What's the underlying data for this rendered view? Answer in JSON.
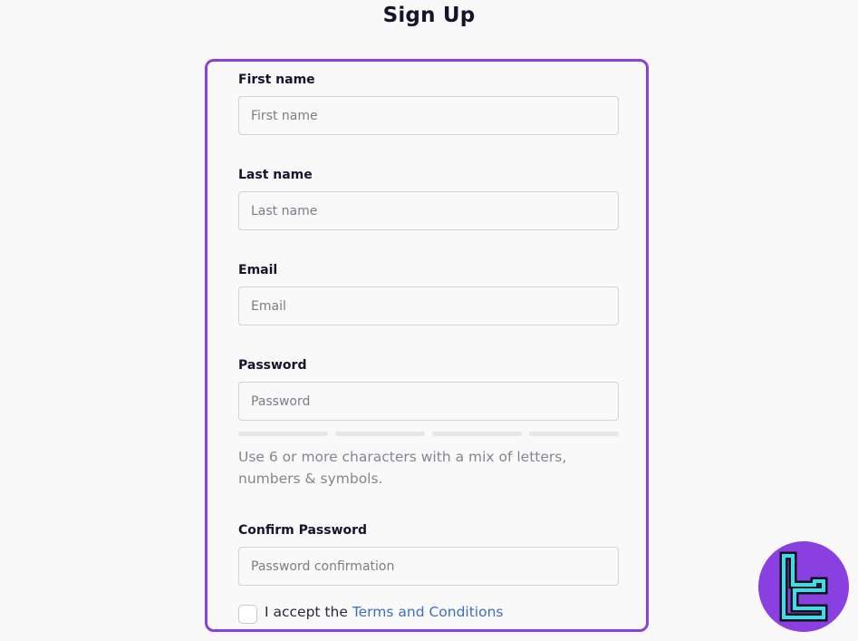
{
  "page": {
    "title": "Sign Up"
  },
  "form": {
    "first_name": {
      "label": "First name",
      "placeholder": "First name",
      "value": ""
    },
    "last_name": {
      "label": "Last name",
      "placeholder": "Last name",
      "value": ""
    },
    "email": {
      "label": "Email",
      "placeholder": "Email",
      "value": ""
    },
    "password": {
      "label": "Password",
      "placeholder": "Password",
      "value": "",
      "strength_segments_total": 4,
      "strength_segments_filled": 0,
      "hint": "Use 6 or more characters with a mix of letters, numbers & symbols."
    },
    "confirm_password": {
      "label": "Confirm Password",
      "placeholder": "Password confirmation",
      "value": ""
    },
    "terms": {
      "checked": false,
      "prefix": "I accept the",
      "link_text": "Terms and Conditions"
    }
  },
  "colors": {
    "highlight_border": "#8a3fe0",
    "link": "#3d6fbf",
    "logo_background": "#8a3fe0",
    "logo_mark": "#33e0f0"
  },
  "logo": {
    "icon": "brand-logo-icon"
  }
}
